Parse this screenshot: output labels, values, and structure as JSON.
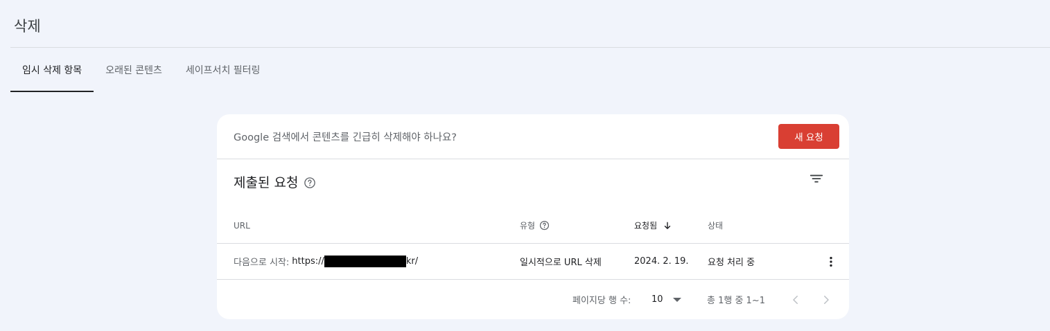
{
  "page": {
    "title": "삭제"
  },
  "tabs": [
    {
      "label": "임시 삭제 항목",
      "active": true
    },
    {
      "label": "오래된 콘텐츠",
      "active": false
    },
    {
      "label": "세이프서치 필터링",
      "active": false
    }
  ],
  "banner": {
    "text": "Google 검색에서 콘텐츠를 긴급히 삭제해야 하나요?",
    "button_label": "새 요청",
    "button_color": "#d93f33"
  },
  "section": {
    "title": "제출된 요청"
  },
  "table": {
    "columns": {
      "url": "URL",
      "type": "유형",
      "requested": "요청됨",
      "status": "상태"
    },
    "sort": {
      "column": "requested",
      "direction": "descending"
    },
    "rows": [
      {
        "url_prefix": "다음으로 시작:",
        "url_start": "https://",
        "url_end": "kr/",
        "type": "일시적으로 URL 삭제",
        "requested": "2024. 2. 19.",
        "status": "요청 처리 중"
      }
    ]
  },
  "pagination": {
    "rows_per_page_label": "페이지당 행 수:",
    "rows_per_page_value": "10",
    "range_text": "총 1행 중 1~1"
  },
  "icons": {
    "help": "help-circle-icon",
    "filter": "filter-icon",
    "sort": "arrow-down-icon",
    "more": "more-vert-icon",
    "dropdown": "caret-down-icon",
    "prev": "chevron-left-icon",
    "next": "chevron-right-icon"
  }
}
